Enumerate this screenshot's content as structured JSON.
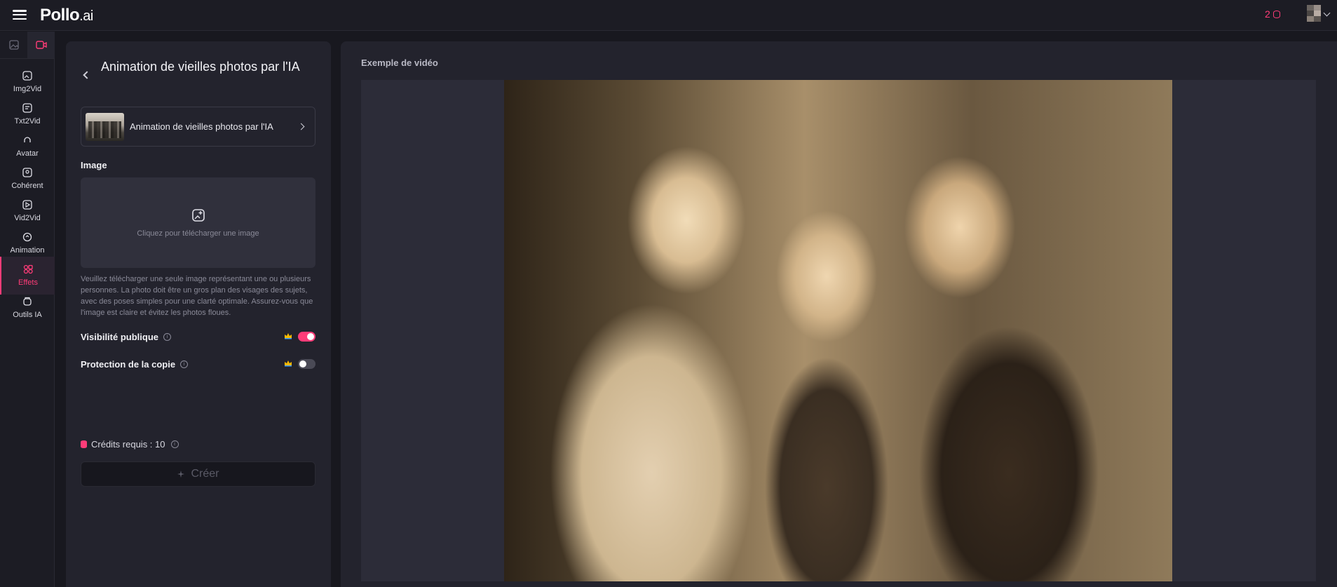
{
  "app": {
    "logo_main": "Pollo",
    "logo_suffix": ".ai",
    "credits_count": "2"
  },
  "nav": {
    "items": [
      {
        "label": "Img2Vid"
      },
      {
        "label": "Txt2Vid"
      },
      {
        "label": "Avatar"
      },
      {
        "label": "Cohérent"
      },
      {
        "label": "Vid2Vid"
      },
      {
        "label": "Animation"
      },
      {
        "label": "Effets"
      },
      {
        "label": "Outils IA"
      }
    ],
    "active": "Effets"
  },
  "panel": {
    "title": "Animation de vieilles photos par l'IA",
    "effect_card_label": "Animation de vieilles photos par l'IA",
    "image_section_label": "Image",
    "upload_text": "Cliquez pour télécharger une image",
    "help_text": "Veuillez télécharger une seule image représentant une ou plusieurs personnes. La photo doit être un gros plan des visages des sujets, avec des poses simples pour une clarté optimale. Assurez-vous que l'image est claire et évitez les photos floues.",
    "public_visibility_label": "Visibilité publique",
    "public_visibility_on": true,
    "copy_protection_label": "Protection de la copie",
    "copy_protection_on": false,
    "credits_required_label": "Crédits requis : 10",
    "create_button_label": "Créer"
  },
  "preview": {
    "label": "Exemple de vidéo"
  },
  "colors": {
    "accent": "#ff3c78",
    "background": "#18181f",
    "panel": "#23232d"
  }
}
